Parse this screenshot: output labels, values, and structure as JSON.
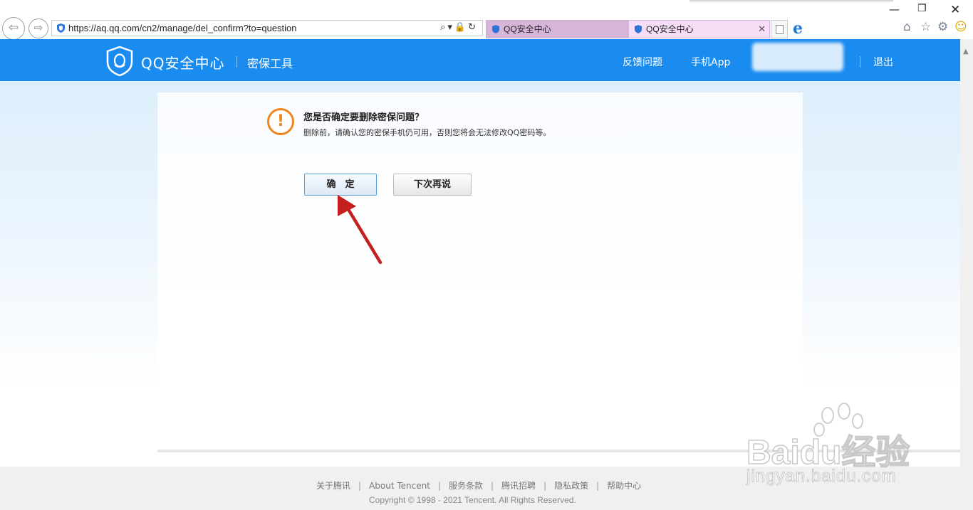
{
  "browser": {
    "url": "https://aq.qq.com/cn2/manage/del_confirm?to=question",
    "address_tools": "⌕▾🔒↻",
    "tabs": [
      {
        "label": "QQ安全中心"
      },
      {
        "label": "QQ安全中心",
        "close": "✕"
      }
    ],
    "window_controls": {
      "minimize": "—",
      "restore": "❐",
      "close": "✕"
    }
  },
  "header": {
    "brand": "QQ安全中心",
    "subbrand": "密保工具",
    "links": {
      "feedback": "反馈问题",
      "app": "手机App",
      "logout": "退出"
    }
  },
  "dialog": {
    "icon": "!",
    "title": "您是否确定要删除密保问题？",
    "subtitle": "删除前，请确认您的密保手机仍可用，否则您将会无法修改QQ密码等。",
    "confirm_label": "确　定",
    "later_label": "下次再说"
  },
  "footer": {
    "links": [
      "关于腾讯",
      "About Tencent",
      "服务条款",
      "腾讯招聘",
      "隐私政策",
      "帮助中心"
    ],
    "separator": "|",
    "copyright": "Copyright © 1998 - 2021 Tencent. All Rights Reserved."
  },
  "watermark": {
    "brand": "Baidu经验",
    "url": "jingyan.baidu.com"
  },
  "colors": {
    "header": "#1a8cf0",
    "warning": "#f0851e",
    "annotation_arrow": "#c41e1e",
    "tab_active": "#d6b5d9"
  }
}
